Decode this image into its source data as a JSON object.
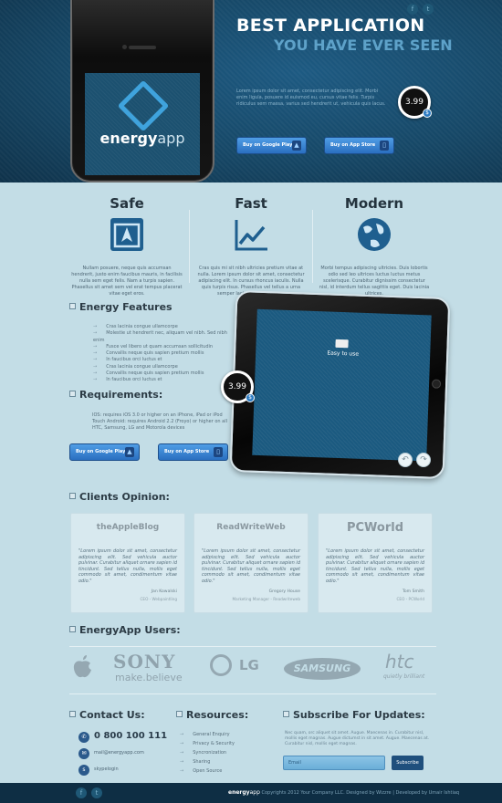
{
  "hero": {
    "title_line1": "BEST APPLICATION",
    "title_line2": "YOU HAVE EVER SEEN",
    "description": "Lorem ipsum dolor sit amet, consectetur adipiscing elit. Morbi enim ligula, posuere id euismod eu, cursus vitae felis. Turpis ridiculus sem massa, varius sed hendrerit ut, vehicula quis lacus.",
    "price": "3.99",
    "currency_symbol": "$",
    "google_play_label": "Buy on Google Play",
    "app_store_label": "Buy on App Store",
    "logo_bold": "energy",
    "logo_light": "app",
    "social": [
      "f",
      "t"
    ]
  },
  "features": [
    {
      "title": "Safe",
      "icon": "shield-box-icon",
      "text": "Nullam posuere, neque quis accumsan hendrerit, justo enim faucibus mauris, in facilisis nulla sem eget felis. Nam a turpis sapien. Phasellus sit amet sem vel erat tempus placerat vitae eget eros."
    },
    {
      "title": "Fast",
      "icon": "chart-up-icon",
      "text": "Cras quis mi sit nibh ultricies pretium vitae at nulla. Lorem ipsum dolor sit amet, consectetur adipiscing elit. In cursus rhoncus iaculis. Nulla quis turpis risus. Phasellus vel tellus a urna semper lacinia quis et neque."
    },
    {
      "title": "Modern",
      "icon": "globe-icon",
      "text": "Morbi tempus adipiscing ultricies. Duis lobortis odio sed leo ultrices luctus luctus metus scelerisque. Curabitur dignissim consectetur nisl, id interdum tellus sagittis eget. Duis lacinia ultrices."
    }
  ],
  "energy_features": {
    "title": "Energy Features",
    "items": [
      "Cras lacinia congue ullamcorpe",
      "Molestie ut hendrerit nec, aliquam vel nibh. Sed nibh enim",
      "Fusce vel libero ut quam accumsan sollicitudin",
      "Convallis neque quis sapien pretium mollis",
      "In faucibus orci luctus et",
      "Cras lacinia congue ullamcorpe",
      "Convallis neque quis sapien pretium mollis",
      "In faucibus orci luctus et"
    ]
  },
  "requirements": {
    "title": "Requirements:",
    "text": "IOS: requires iOS 3.0 or higher on an iPhone, iPad or iPod Touch Android: requires Android 2.2 (Froyo) or higher on all HTC, Samsung, LG and Motorola devices",
    "google_play_label": "Buy on Google Play",
    "app_store_label": "Buy on App Store"
  },
  "tablet": {
    "caption": "Easy to use",
    "price": "3.99",
    "currency_symbol": "$"
  },
  "clients": {
    "title": "Clients Opinion:",
    "cards": [
      {
        "brand": "theAppleBlog",
        "quote": "\"Lorem ipsum dolor sit amet, consectetur adipiscing elit. Sed vehicula auctor pulvinar. Curabitur aliquet ornare sapien id tincidunt. Sed tellus nulla, mollis eget commodo sit amet, condimentum vitae odio.\"",
        "name": "Jan Kowalski",
        "role": "CEO - Webpaintling"
      },
      {
        "brand": "ReadWriteWeb",
        "quote": "\"Lorem ipsum dolor sit amet, consectetur adipiscing elit. Sed vehicula auctor pulvinar. Curabitur aliquet ornare sapien id tincidunt. Sed tellus nulla, mollis eget commodo sit amet, condimentum vitae odio.\"",
        "name": "Gregory House",
        "role": "Marketing Manager - Readwriteweb"
      },
      {
        "brand": "PCWorld",
        "quote": "\"Lorem ipsum dolor sit amet, consectetur adipiscing elit. Sed vehicula auctor pulvinar. Curabitur aliquet ornare sapien id tincidunt. Sed tellus nulla, mollis eget commodo sit amet, condimentum vitae odio.\"",
        "name": "Tom Smith",
        "role": "CEO - PCWorld"
      }
    ]
  },
  "users": {
    "title": "EnergyApp Users:",
    "logos": [
      "SONY",
      "make.believe",
      "LG",
      "SAMSUNG",
      "htc",
      "quietly brilliant"
    ]
  },
  "contact": {
    "title": "Contact Us:",
    "phone": "0 800 100 111",
    "email": "mail@energyapp.com",
    "skype": "skypelogin"
  },
  "resources": {
    "title": "Resources:",
    "items": [
      "General Enquiry",
      "Privacy & Security",
      "Syncronization",
      "Sharing",
      "Open Source"
    ]
  },
  "subscribe": {
    "title": "Subscribe For Updates:",
    "text": "Nec quam, orc aliquet sit amet. Augue. Maecenas in. Curabitur nisl, mollis eget magnas. Augue dictumst in sit amet. Augue. Maecenas at. Curabitur nisl, mollis eget magnas.",
    "placeholder": "Email",
    "button": "Subscribe"
  },
  "footer": {
    "logo_bold": "energy",
    "logo_light": "app",
    "copyright": "Copyrights 2012 Your Company LLC. Designed by Wizzre | Developed by Umair Ishtiaq"
  },
  "colors": {
    "accent": "#2b7ac2",
    "hero_bg": "#164766",
    "page_bg": "#c3dde6"
  }
}
